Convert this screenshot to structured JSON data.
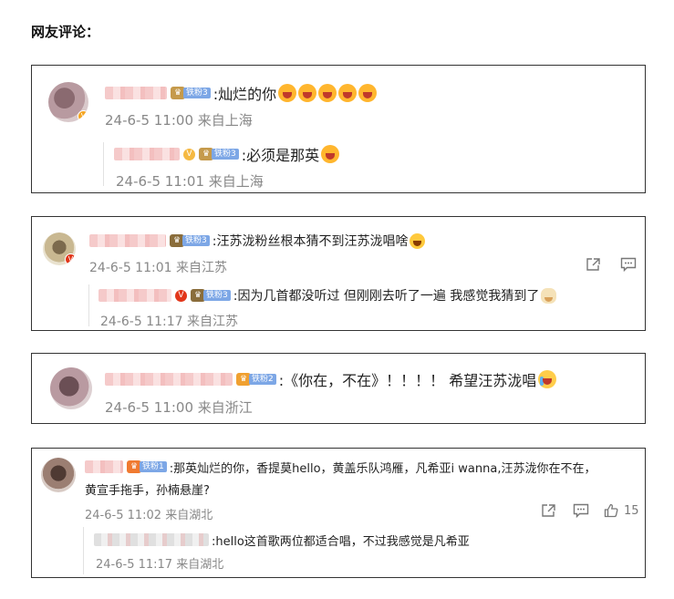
{
  "heading": "网友评论：",
  "comments": [
    {
      "fan_level": "铁粉3",
      "text": ":灿烂的你",
      "time": "24-6-5 11:00",
      "location": "来自上海",
      "reply": {
        "fan_level": "铁粉3",
        "text": ":必须是那英",
        "time": "24-6-5 11:01",
        "location": "来自上海"
      }
    },
    {
      "fan_level": "铁粉3",
      "text": ":汪苏泷粉丝根本猜不到汪苏泷唱啥",
      "time": "24-6-5 11:01",
      "location": "来自江苏",
      "actions": [
        "share-icon",
        "comment-icon"
      ],
      "reply": {
        "fan_level": "铁粉3",
        "text": ":因为几首都没听过 但刚刚去听了一遍 我感觉我猜到了",
        "time": "24-6-5 11:17",
        "location": "来自江苏"
      }
    },
    {
      "fan_level": "铁粉2",
      "text": ":《你在，不在》！！！！ 希望汪苏泷唱",
      "time": "24-6-5 11:00",
      "location": "来自浙江"
    },
    {
      "fan_level": "铁粉1",
      "text_line1": ":那英灿烂的你，香提莫hello，黄盖乐队鸿雁，凡希亚i wanna,汪苏泷你在不在，",
      "text_line2": "黄宣手拖手，孙楠悬崖?",
      "time": "24-6-5 11:02",
      "location": "来自湖北",
      "like_count": "15",
      "actions": [
        "share-icon",
        "comment-icon",
        "like-icon"
      ],
      "reply": {
        "text": ":hello这首歌两位都适合唱，不过我感觉是凡希亚",
        "time": "24-6-5 11:17",
        "location": "来自湖北"
      }
    }
  ],
  "colors": {
    "border": "#333333",
    "meta": "#888888",
    "fan_badge": "#7da7e6"
  }
}
